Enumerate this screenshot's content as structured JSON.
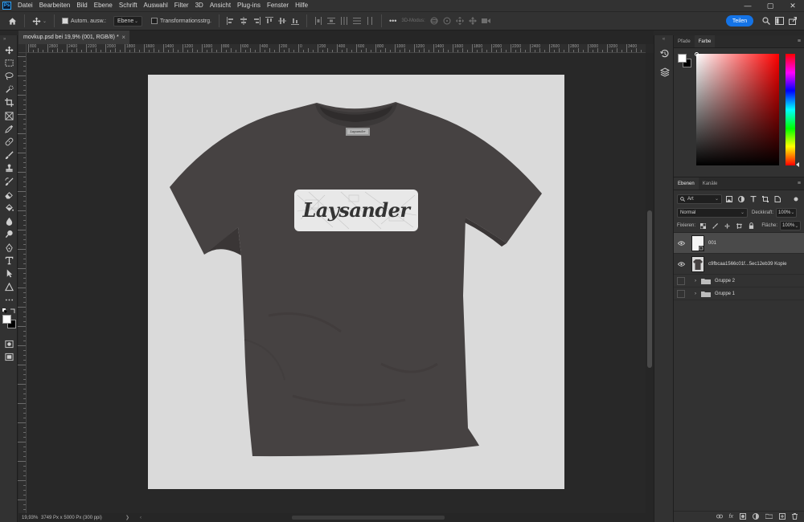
{
  "menubar": {
    "logo": "Ps",
    "items": [
      "Datei",
      "Bearbeiten",
      "Bild",
      "Ebene",
      "Schrift",
      "Auswahl",
      "Filter",
      "3D",
      "Ansicht",
      "Plug-ins",
      "Fenster",
      "Hilfe"
    ],
    "window_controls": [
      "—",
      "▢",
      "✕"
    ]
  },
  "optionsbar": {
    "auto_select_label": "Autom. ausw.:",
    "auto_select_checked": true,
    "auto_select_target": "Ebene",
    "transform_controls_label": "Transformationsstrg.",
    "transform_controls_checked": false,
    "more_label": "•••",
    "mode_3d_label": "3D-Modus:",
    "share_label": "Teilen"
  },
  "document": {
    "tab_title": "movkup.psd bei 19,9% (001, RGB/8) *",
    "close_glyph": "×"
  },
  "ruler_top_labels": [
    "800",
    "2800",
    "2400",
    "2200",
    "2000",
    "1800",
    "1600",
    "1400",
    "1200",
    "1000",
    "800",
    "600",
    "400",
    "200",
    "0",
    "200",
    "400",
    "600",
    "800",
    "1000",
    "1200",
    "1400",
    "1600",
    "1800",
    "2000",
    "2200",
    "2400",
    "2600",
    "2800",
    "3000",
    "3200",
    "3400",
    "3600",
    "3800",
    "4000",
    "4200",
    "4400",
    "4600",
    "4800",
    "5000"
  ],
  "mockup": {
    "neck_label": "Laysander",
    "print_text": "Laysander",
    "shirt_color": "#464242",
    "background_color": "#dadada"
  },
  "statusbar": {
    "zoom": "19,93%",
    "doc_info": "3749 Px x 5000 Px (300 ppi)",
    "arrow": "❯",
    "left_arrow": "‹"
  },
  "color_panel": {
    "tabs": [
      "Pfade",
      "Farbe"
    ],
    "active_tab": "Farbe",
    "foreground": "#ffffff",
    "background": "#000000",
    "hue": "#ff0000"
  },
  "layers_panel": {
    "tabs": [
      "Ebenen",
      "Kanäle"
    ],
    "active_tab": "Ebenen",
    "filter_label": "Art",
    "blend_mode": "Normal",
    "opacity_label": "Deckkraft:",
    "opacity_value": "100%",
    "lock_label": "Fixieren:",
    "fill_label": "Fläche:",
    "fill_value": "100%",
    "layers": [
      {
        "name": "001",
        "visible": true,
        "selected": true,
        "type": "smart-object"
      },
      {
        "name": "c9fbcaa1566c01f...5ec12eb39 Kopie",
        "visible": true,
        "selected": false,
        "type": "image"
      },
      {
        "name": "Gruppe 2",
        "visible": false,
        "selected": false,
        "type": "group"
      },
      {
        "name": "Gruppe 1",
        "visible": false,
        "selected": false,
        "type": "group"
      }
    ],
    "footer_icons": [
      "link-icon",
      "fx-icon",
      "mask-icon",
      "adjustment-icon",
      "group-icon",
      "new-layer-icon",
      "trash-icon"
    ],
    "footer_fx": "fx"
  },
  "colors": {
    "accent": "#1473e6",
    "panel_bg": "#323232",
    "canvas_bg": "#282828"
  }
}
